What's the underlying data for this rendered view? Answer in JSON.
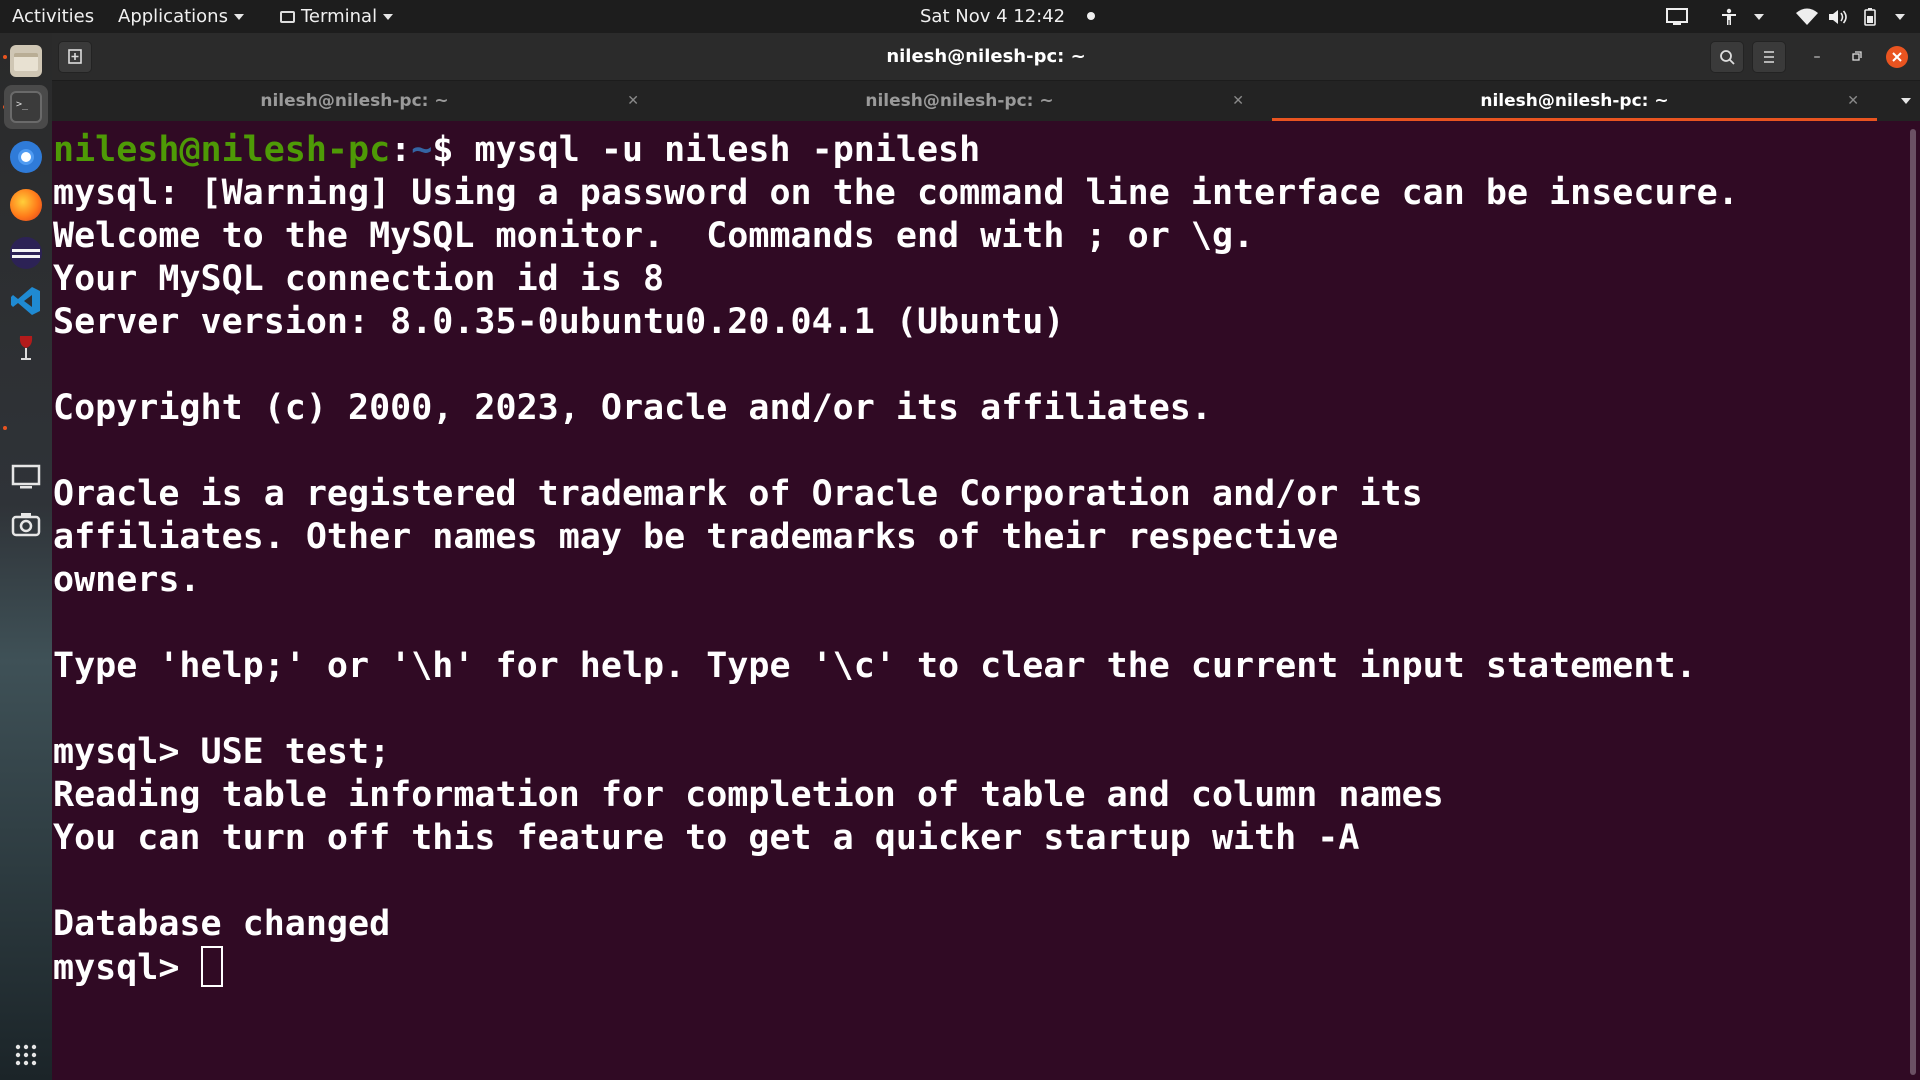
{
  "topbar": {
    "activities": "Activities",
    "applications": "Applications",
    "app_menu": "Terminal",
    "clock": "Sat Nov 4  12:42"
  },
  "dock": {
    "items": [
      "files",
      "terminal",
      "chromium",
      "firefox",
      "eclipse",
      "vscode",
      "wine",
      "screen",
      "camera"
    ],
    "apps_grid": "show-applications"
  },
  "window": {
    "title": "nilesh@nilesh-pc: ~",
    "tabs": [
      {
        "label": "nilesh@nilesh-pc: ~",
        "active": false
      },
      {
        "label": "nilesh@nilesh-pc: ~",
        "active": false
      },
      {
        "label": "nilesh@nilesh-pc: ~",
        "active": true
      }
    ],
    "accent": "#e95420"
  },
  "terminal": {
    "prompt_user": "nilesh@nilesh-pc",
    "prompt_sep": ":",
    "prompt_path": "~",
    "prompt_end": "$ ",
    "command": "mysql -u nilesh -pnilesh",
    "output": [
      "mysql: [Warning] Using a password on the command line interface can be insecure.",
      "Welcome to the MySQL monitor.  Commands end with ; or \\g.",
      "Your MySQL connection id is 8",
      "Server version: 8.0.35-0ubuntu0.20.04.1 (Ubuntu)",
      "",
      "Copyright (c) 2000, 2023, Oracle and/or its affiliates.",
      "",
      "Oracle is a registered trademark of Oracle Corporation and/or its",
      "affiliates. Other names may be trademarks of their respective",
      "owners.",
      "",
      "Type 'help;' or '\\h' for help. Type '\\c' to clear the current input statement.",
      "",
      "mysql> USE test;",
      "Reading table information for completion of table and column names",
      "You can turn off this feature to get a quicker startup with -A",
      "",
      "Database changed"
    ],
    "current_prompt": "mysql> "
  }
}
